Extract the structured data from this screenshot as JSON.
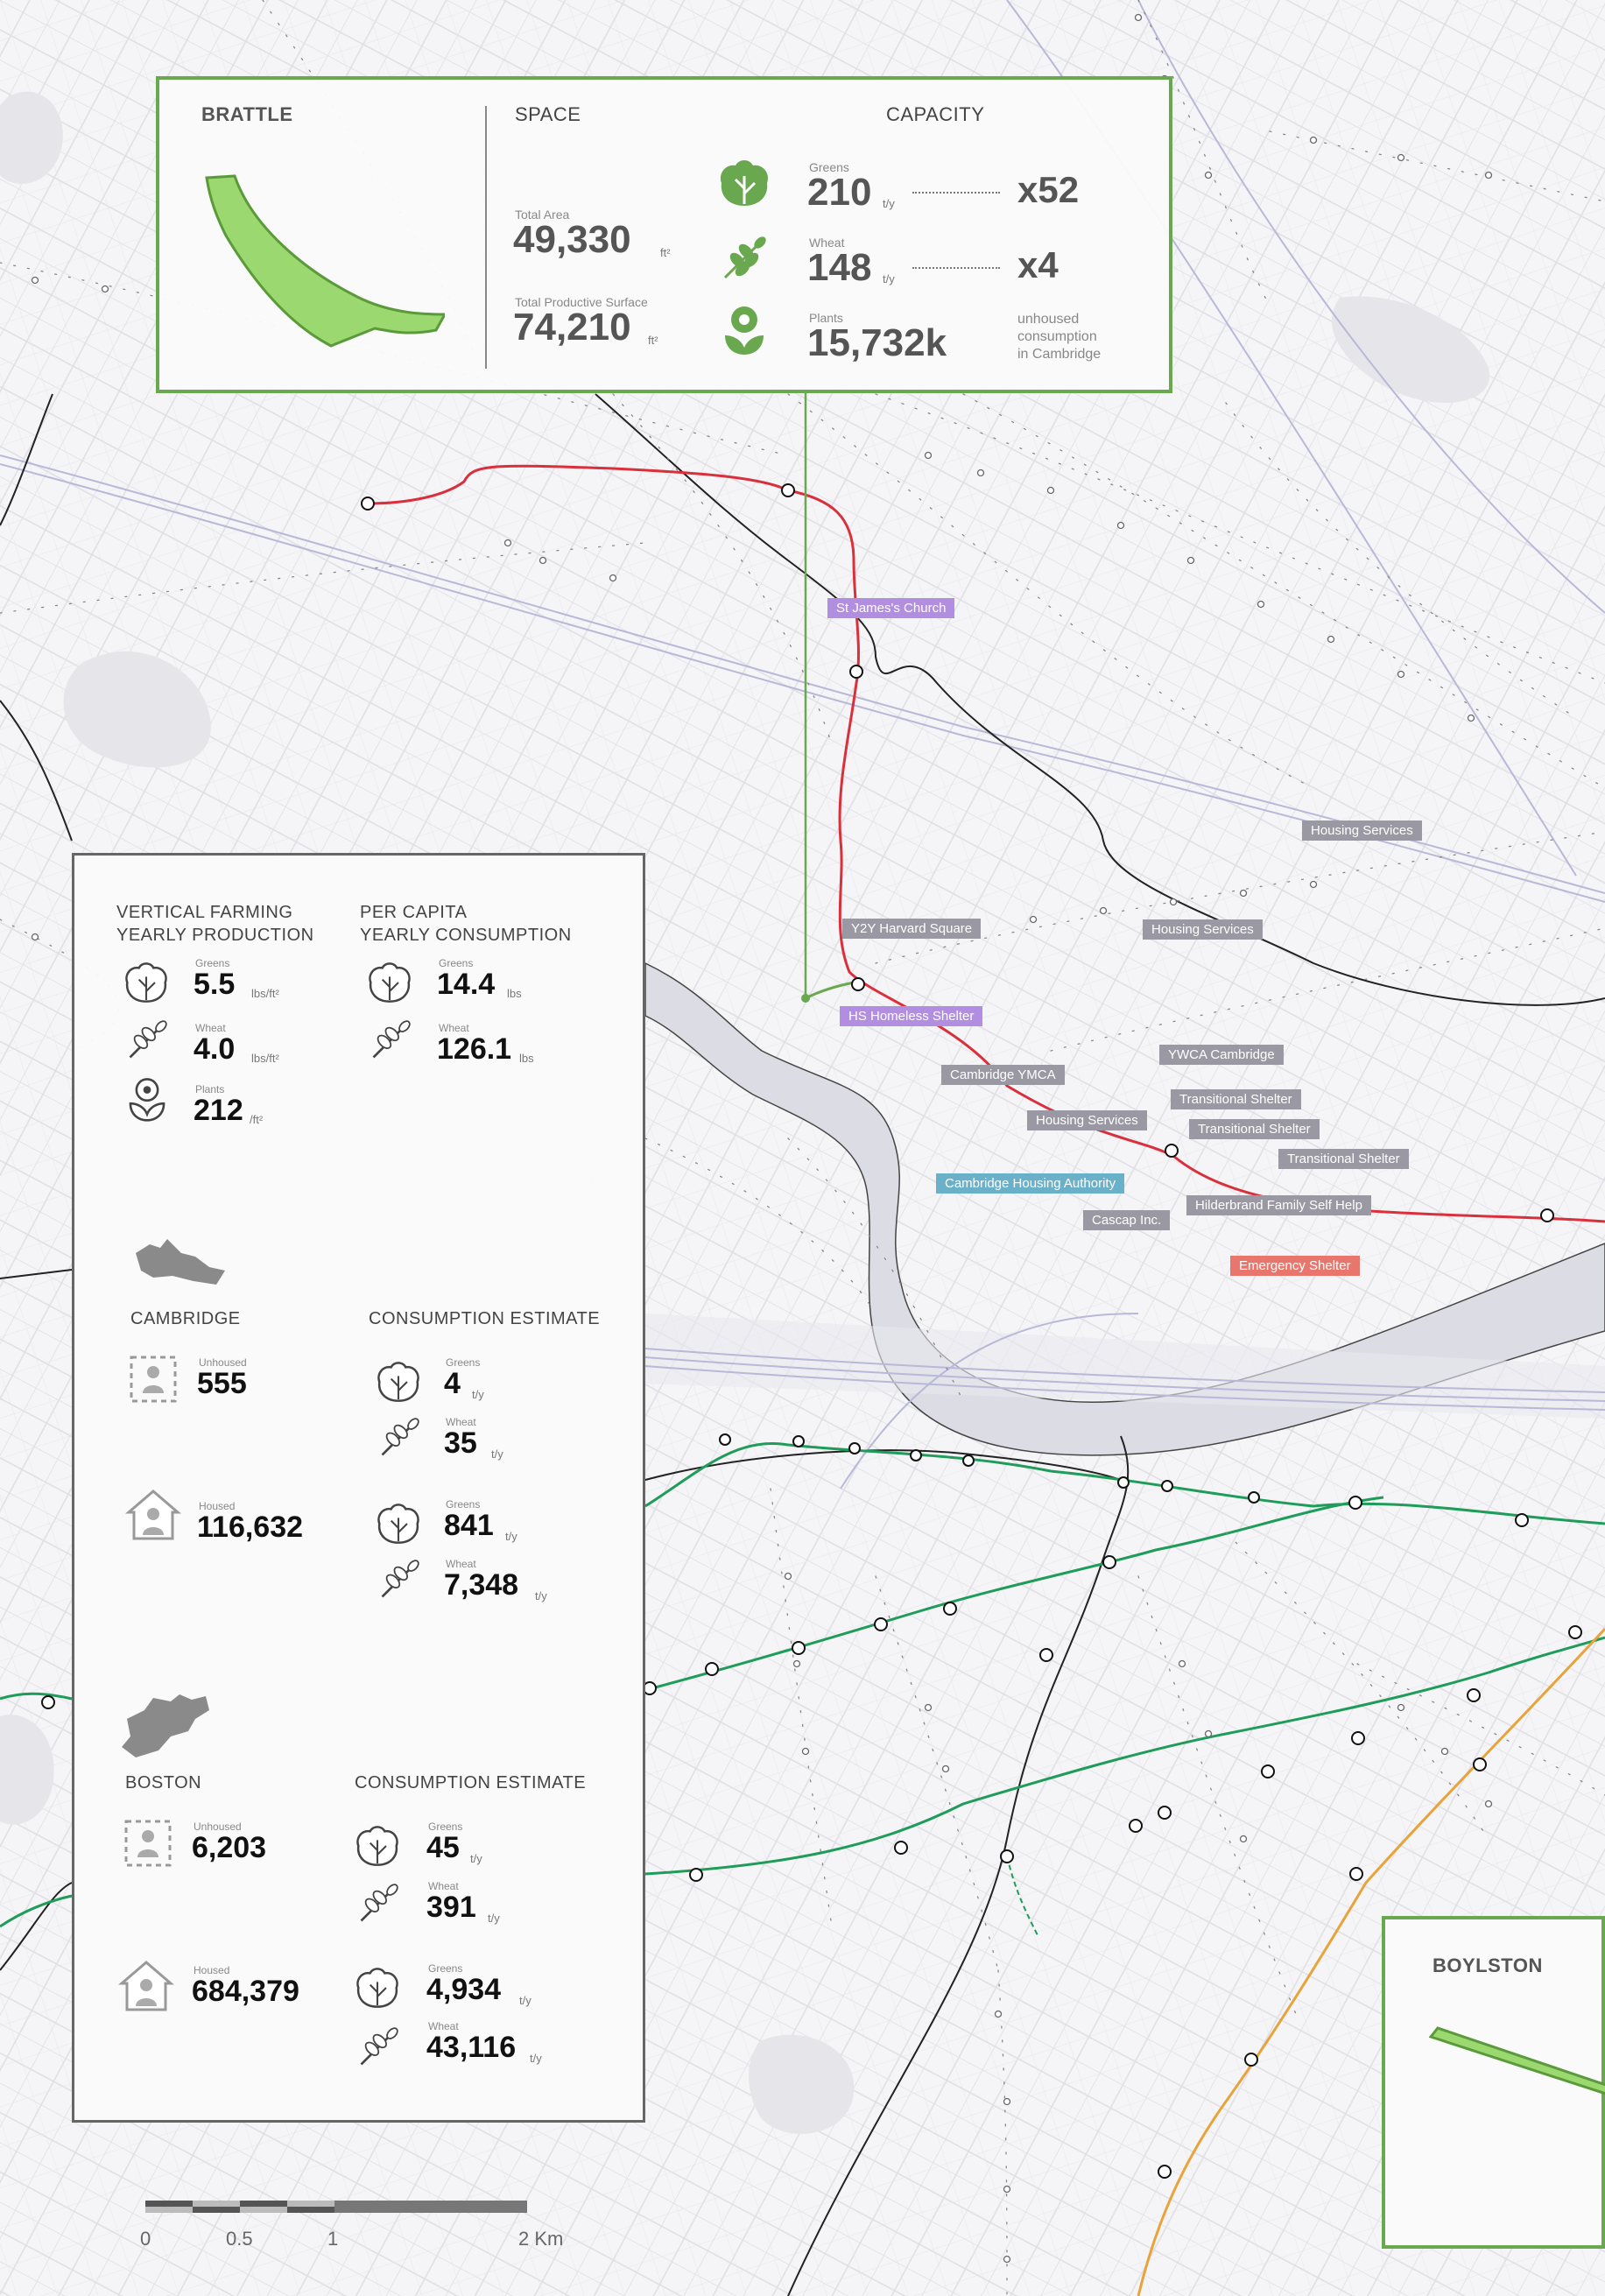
{
  "brattle": {
    "title": "BRATTLE",
    "space_header": "SPACE",
    "capacity_header": "CAPACITY",
    "total_area_label": "Total Area",
    "total_area_value": "49,330",
    "total_area_unit": "ft²",
    "productive_label": "Total Productive Surface",
    "productive_value": "74,210",
    "productive_unit": "ft²",
    "greens_label": "Greens",
    "greens_value": "210",
    "greens_unit": "t/y",
    "greens_mult": "x52",
    "wheat_label": "Wheat",
    "wheat_value": "148",
    "wheat_unit": "t/y",
    "wheat_mult": "x4",
    "plants_label": "Plants",
    "plants_value": "15,732k",
    "note_line1": "unhoused",
    "note_line2": "consumption",
    "note_line3": "in Cambridge",
    "accent_color": "#6aa84f"
  },
  "stats": {
    "vf_title_1": "VERTICAL FARMING",
    "vf_title_2": "YEARLY PRODUCTION",
    "pc_title_1": "PER CAPITA",
    "pc_title_2": "YEARLY CONSUMPTION",
    "vf_greens_label": "Greens",
    "vf_greens_value": "5.5",
    "vf_greens_unit": "lbs/ft²",
    "vf_wheat_label": "Wheat",
    "vf_wheat_value": "4.0",
    "vf_wheat_unit": "lbs/ft²",
    "vf_plants_label": "Plants",
    "vf_plants_value": "212",
    "vf_plants_unit": "/ft²",
    "pc_greens_label": "Greens",
    "pc_greens_value": "14.4",
    "pc_greens_unit": "lbs",
    "pc_wheat_label": "Wheat",
    "pc_wheat_value": "126.1",
    "pc_wheat_unit": "lbs",
    "cambridge": {
      "title": "CAMBRIDGE",
      "estimate_title": "CONSUMPTION ESTIMATE",
      "unhoused_label": "Unhoused",
      "unhoused_value": "555",
      "housed_label": "Housed",
      "housed_value": "116,632",
      "u_greens_label": "Greens",
      "u_greens_value": "4",
      "u_greens_unit": "t/y",
      "u_wheat_label": "Wheat",
      "u_wheat_value": "35",
      "u_wheat_unit": "t/y",
      "h_greens_label": "Greens",
      "h_greens_value": "841",
      "h_greens_unit": "t/y",
      "h_wheat_label": "Wheat",
      "h_wheat_value": "7,348",
      "h_wheat_unit": "t/y"
    },
    "boston": {
      "title": "BOSTON",
      "estimate_title": "CONSUMPTION ESTIMATE",
      "unhoused_label": "Unhoused",
      "unhoused_value": "6,203",
      "housed_label": "Housed",
      "housed_value": "684,379",
      "u_greens_label": "Greens",
      "u_greens_value": "45",
      "u_greens_unit": "t/y",
      "u_wheat_label": "Wheat",
      "u_wheat_value": "391",
      "u_wheat_unit": "t/y",
      "h_greens_label": "Greens",
      "h_greens_value": "4,934",
      "h_greens_unit": "t/y",
      "h_wheat_label": "Wheat",
      "h_wheat_value": "43,116",
      "h_wheat_unit": "t/y"
    }
  },
  "boylston": {
    "title": "BOYLSTON"
  },
  "map_labels": {
    "st_james": "St James's Church",
    "housing_1": "Housing Services",
    "y2y": "Y2Y Harvard Square",
    "housing_2": "Housing Services",
    "hs_homeless": "HS Homeless Shelter",
    "ywca": "YWCA Cambridge",
    "cambridge_ymca": "Cambridge YMCA",
    "transitional_1": "Transitional Shelter",
    "housing_3": "Housing Services",
    "transitional_2": "Transitional Shelter",
    "transitional_3": "Transitional Shelter",
    "cambridge_housing": "Cambridge Housing Authority",
    "hilderbrand": "Hilderbrand Family Self Help",
    "cascap": "Cascap Inc.",
    "emergency": "Emergency Shelter"
  },
  "scale": {
    "l0": "0",
    "l1": "0.5",
    "l2": "1",
    "l3": "2 Km"
  },
  "colors": {
    "red_line": "#d9303c",
    "green_line": "#1f9c5a",
    "orange_line": "#e8a33a",
    "water": "#e3e3e8",
    "river": "#d8d8e0",
    "tag_gray": "#9a99a3",
    "tag_purple": "#b28ee0",
    "tag_blue": "#6ab0c8",
    "tag_red": "#e8766c"
  }
}
